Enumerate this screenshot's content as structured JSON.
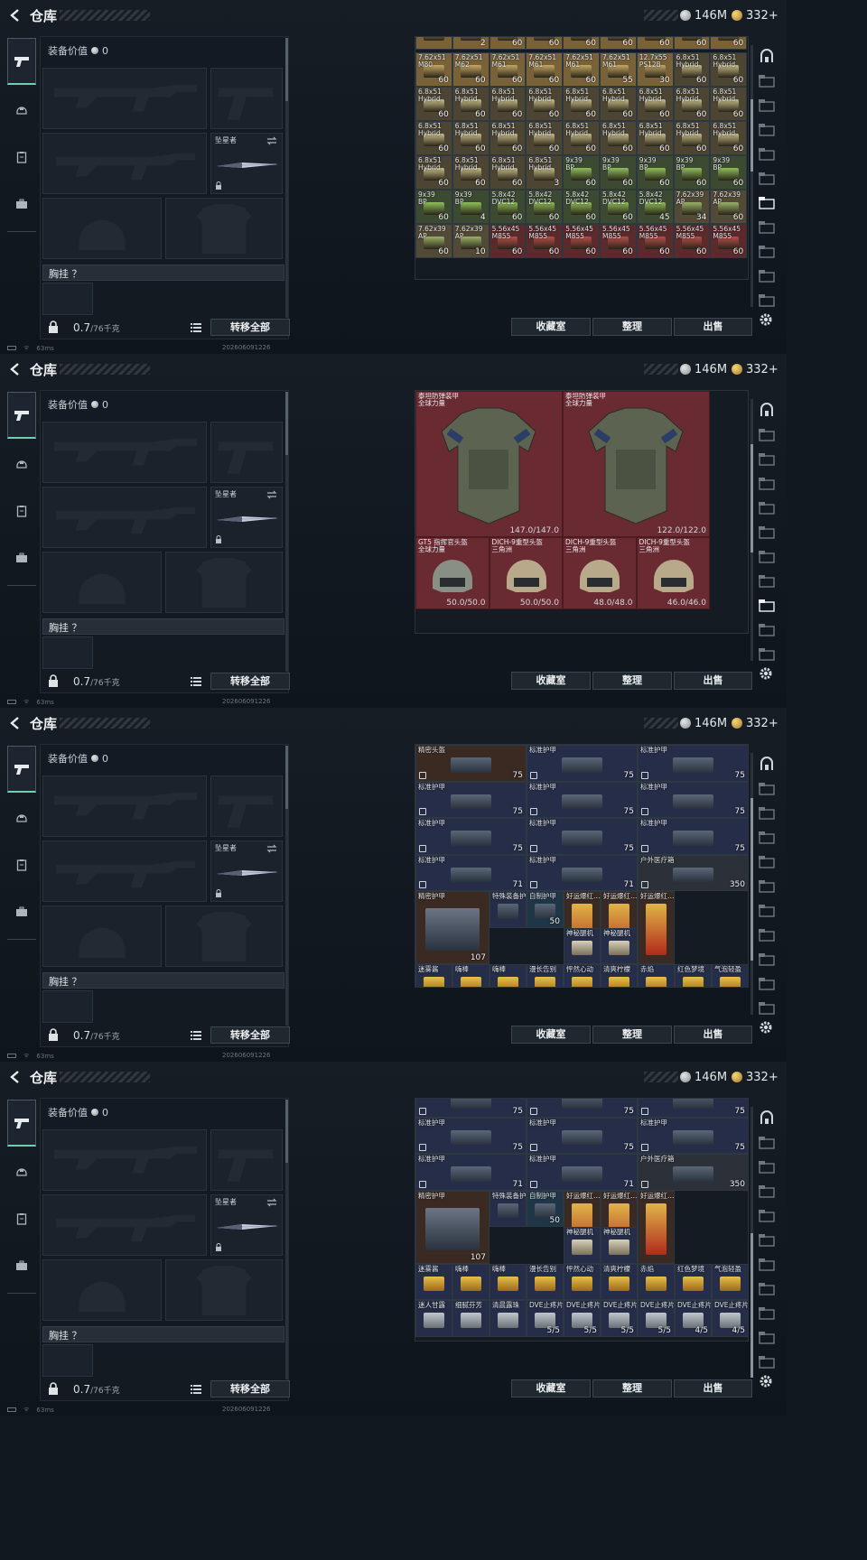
{
  "page_title": "仓库",
  "currency": {
    "silver": "146M",
    "gold": "332+"
  },
  "equip": {
    "value_label": "装备价值",
    "value": "0",
    "knife_label": "坠星者",
    "vest_label": "胸挂 ？",
    "weight": "0.7",
    "weight_max": "/76千克",
    "transfer_all": "转移全部"
  },
  "buttons": {
    "collection": "收藏室",
    "sort": "整理",
    "sell": "出售"
  },
  "status": {
    "ping": "63ms",
    "timestamp": "202606091226"
  },
  "colors": {
    "accent": "#6fd0b0",
    "ammo_tan": "#9a7a45",
    "armor_red": "#6a2a31",
    "item_blue": "#2a3048"
  },
  "views": [
    {
      "name": "ammo",
      "rows": [
        [
          [
            "",
            ""
          ],
          [
            "",
            "2"
          ],
          [
            "",
            "60"
          ],
          [
            "",
            "60"
          ],
          [
            "",
            "60"
          ],
          [
            "",
            "60"
          ],
          [
            "",
            "60"
          ],
          [
            "",
            "60"
          ],
          [
            "",
            "60"
          ]
        ],
        [
          [
            "7.62x51\nM80",
            "60"
          ],
          [
            "7.62x51\nM62",
            "60"
          ],
          [
            "7.62x51\nM61",
            "60"
          ],
          [
            "7.62x51\nM61",
            "60"
          ],
          [
            "7.62x51\nM61",
            "60"
          ],
          [
            "7.62x51\nM61",
            "55"
          ],
          [
            "12.7x55\nPS12B",
            "30"
          ],
          [
            "6.8x51\nHybrid",
            "60"
          ],
          [
            "6.8x51\nHybrid",
            "60"
          ]
        ],
        [
          [
            "6.8x51\nHybrid",
            "60"
          ],
          [
            "6.8x51\nHybrid",
            "60"
          ],
          [
            "6.8x51\nHybrid",
            "60"
          ],
          [
            "6.8x51\nHybrid",
            "60"
          ],
          [
            "6.8x51\nHybrid",
            "60"
          ],
          [
            "6.8x51\nHybrid",
            "60"
          ],
          [
            "6.8x51\nHybrid",
            "60"
          ],
          [
            "6.8x51\nHybrid",
            "60"
          ],
          [
            "6.8x51\nHybrid",
            "60"
          ]
        ],
        [
          [
            "6.8x51\nHybrid",
            "60"
          ],
          [
            "6.8x51\nHybrid",
            "60"
          ],
          [
            "6.8x51\nHybrid",
            "60"
          ],
          [
            "6.8x51\nHybrid",
            "60"
          ],
          [
            "6.8x51\nHybrid",
            "60"
          ],
          [
            "6.8x51\nHybrid",
            "60"
          ],
          [
            "6.8x51\nHybrid",
            "60"
          ],
          [
            "6.8x51\nHybrid",
            "60"
          ],
          [
            "6.8x51\nHybrid",
            "60"
          ]
        ],
        [
          [
            "6.8x51\nHybrid",
            "60"
          ],
          [
            "6.8x51\nHybrid",
            "60"
          ],
          [
            "6.8x51\nHybrid",
            "60"
          ],
          [
            "6.8x51\nHybrid",
            "3"
          ],
          [
            "9x39\nBP",
            "60"
          ],
          [
            "9x39\nBP",
            "60"
          ],
          [
            "9x39\nBP",
            "60"
          ],
          [
            "9x39\nBP",
            "60"
          ],
          [
            "9x39\nBP",
            "60"
          ]
        ],
        [
          [
            "9x39\nBP",
            "60"
          ],
          [
            "9x39\nBP",
            "4"
          ],
          [
            "5.8x42\nDVC12",
            "60"
          ],
          [
            "5.8x42\nDVC12",
            "60"
          ],
          [
            "5.8x42\nDVC12",
            "60"
          ],
          [
            "5.8x42\nDVC12",
            "60"
          ],
          [
            "5.8x42\nDVC12",
            "45"
          ],
          [
            "7.62x39\nAP",
            "34"
          ],
          [
            "7.62x39\nAP",
            "60"
          ]
        ],
        [
          [
            "7.62x39\nAP",
            "60"
          ],
          [
            "7.62x39\nAP",
            "10"
          ],
          [
            "5.56x45\nM855",
            "60"
          ],
          [
            "5.56x45\nM855",
            "60"
          ],
          [
            "5.56x45\nM855",
            "60"
          ],
          [
            "5.56x45\nM855",
            "60"
          ],
          [
            "5.56x45\nM855",
            "60"
          ],
          [
            "5.56x45\nM855",
            "60"
          ],
          [
            "5.56x45\nM855",
            "60"
          ]
        ]
      ]
    },
    {
      "name": "armor",
      "large": [
        {
          "name": "泰坦防弹装甲\n全球力量",
          "dur": "147.0/147.0"
        },
        {
          "name": "泰坦防弹装甲\n全球力量",
          "dur": "122.0/122.0"
        }
      ],
      "small": [
        {
          "name": "GT5 指挥官头盔\n全球力量",
          "dur": "50.0/50.0"
        },
        {
          "name": "DICH-9重型头盔\n三角洲",
          "dur": "50.0/50.0"
        },
        {
          "name": "DICH-9重型头盔\n三角洲",
          "dur": "48.0/48.0"
        },
        {
          "name": "DICH-9重型头盔\n三角洲",
          "dur": "46.0/46.0"
        }
      ]
    },
    {
      "name": "gear1",
      "rows": [
        [
          [
            "精密头盔",
            "75"
          ],
          [
            "标准护甲",
            "75"
          ],
          [
            "标准护甲",
            "75"
          ]
        ],
        [
          [
            "标准护甲",
            "75"
          ],
          [
            "标准护甲",
            "75"
          ],
          [
            "标准护甲",
            "75"
          ]
        ],
        [
          [
            "标准护甲",
            "75"
          ],
          [
            "标准护甲",
            "75"
          ],
          [
            "标准护甲",
            "75"
          ]
        ],
        [
          [
            "标准护甲",
            "71"
          ],
          [
            "标准护甲",
            "71"
          ],
          [
            "户外医疗箱",
            "350"
          ]
        ]
      ],
      "row5_big": {
        "name": "精密护甲",
        "val": "107"
      },
      "row5_top": [
        [
          "特殊装备护甲",
          ""
        ],
        [
          "自制护甲",
          "50"
        ],
        [
          "好运爆红…",
          ""
        ],
        [
          "好运爆红…",
          ""
        ],
        [
          "好运爆红…",
          ""
        ]
      ],
      "row5_bot": [
        [
          "神秘腿机",
          ""
        ],
        [
          "神秘腿机",
          ""
        ]
      ],
      "drinks": [
        [
          "迷雾酱",
          ""
        ],
        [
          "嗨棒",
          ""
        ],
        [
          "嗨棒",
          ""
        ],
        [
          "漫长告别",
          ""
        ],
        [
          "怦然心动",
          ""
        ],
        [
          "清爽柠檬",
          ""
        ],
        [
          "赤焰",
          ""
        ],
        [
          "红色梦境",
          ""
        ],
        [
          "气泡轻盈",
          ""
        ]
      ],
      "meds": [
        [
          "迷人甘露",
          ""
        ],
        [
          "细腻芬芳",
          ""
        ],
        [
          "清晨露珠",
          ""
        ],
        [
          "DVE止疼片",
          ""
        ],
        [
          "DVE止疼片",
          ""
        ],
        [
          "DVE止疼片",
          ""
        ],
        [
          "DVE止疼片",
          ""
        ],
        [
          "DVE止疼片",
          ""
        ],
        [
          "DVE止疼片",
          ""
        ]
      ]
    },
    {
      "name": "gear2",
      "rows": [
        [
          [
            "",
            "75"
          ],
          [
            "",
            "75"
          ],
          [
            "",
            "75"
          ]
        ],
        [
          [
            "标准护甲",
            "75"
          ],
          [
            "标准护甲",
            "75"
          ],
          [
            "标准护甲",
            "75"
          ]
        ],
        [
          [
            "标准护甲",
            "71"
          ],
          [
            "标准护甲",
            "71"
          ],
          [
            "户外医疗箱",
            "350"
          ]
        ]
      ],
      "row5_big": {
        "name": "精密护甲",
        "val": "107"
      },
      "row5_top": [
        [
          "特殊装备护甲",
          ""
        ],
        [
          "自制护甲",
          "50"
        ],
        [
          "好运爆红…",
          ""
        ],
        [
          "好运爆红…",
          ""
        ],
        [
          "好运爆红…",
          ""
        ]
      ],
      "row5_bot": [
        [
          "神秘腿机",
          ""
        ],
        [
          "神秘腿机",
          ""
        ]
      ],
      "drinks": [
        [
          "迷雾酱",
          ""
        ],
        [
          "嗨棒",
          ""
        ],
        [
          "嗨棒",
          ""
        ],
        [
          "漫长告别",
          ""
        ],
        [
          "怦然心动",
          ""
        ],
        [
          "清爽柠檬",
          ""
        ],
        [
          "赤焰",
          ""
        ],
        [
          "红色梦境",
          ""
        ],
        [
          "气泡轻盈",
          ""
        ]
      ],
      "meds": [
        [
          "迷人甘露",
          ""
        ],
        [
          "细腻芬芳",
          ""
        ],
        [
          "清晨露珠",
          ""
        ],
        [
          "DVE止疼片",
          "5/5"
        ],
        [
          "DVE止疼片",
          "5/5"
        ],
        [
          "DVE止疼片",
          "5/5"
        ],
        [
          "DVE止疼片",
          "5/5"
        ],
        [
          "DVE止疼片",
          "4/5"
        ],
        [
          "DVE止疼片",
          "4/5"
        ]
      ]
    }
  ]
}
